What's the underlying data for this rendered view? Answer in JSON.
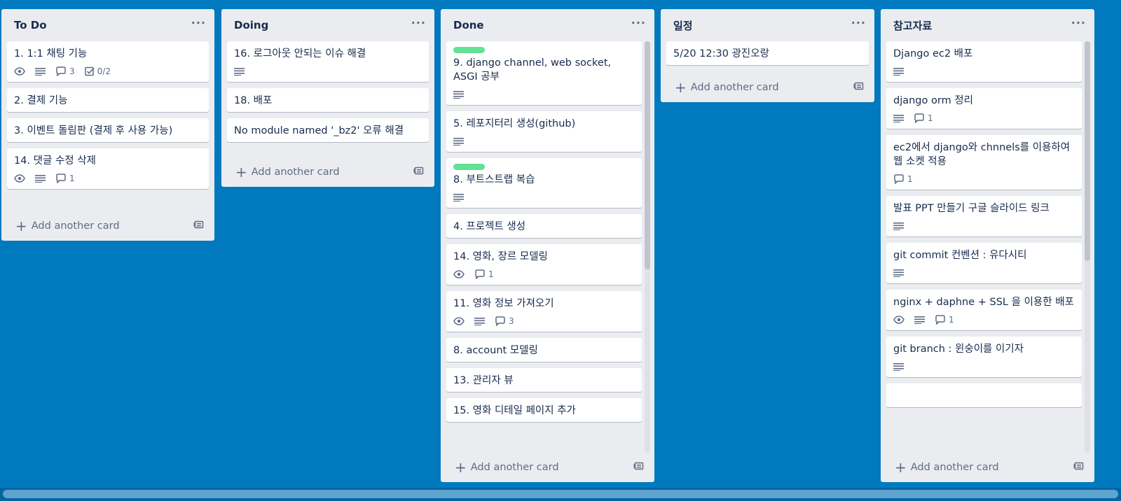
{
  "board": {
    "lists": [
      {
        "title": "To Do",
        "menu": "···",
        "add_card": "Add another card",
        "cards": [
          {
            "title": "1. 1:1 채팅 기능",
            "watch": true,
            "description": true,
            "comments": "3",
            "checklist": "0/2"
          },
          {
            "title": "2. 결제 기능"
          },
          {
            "title": "3. 이벤트 돌림판 (결제 후 사용 가능)"
          },
          {
            "title": "14. 댓글 수정 삭제",
            "watch": true,
            "description": true,
            "comments": "1"
          }
        ]
      },
      {
        "title": "Doing",
        "menu": "···",
        "add_card": "Add another card",
        "cards": [
          {
            "title": "16. 로그아웃 안되는 이슈 해결",
            "description": true
          },
          {
            "title": "18. 배포"
          },
          {
            "title": "No module named '_bz2' 오류 해결"
          }
        ]
      },
      {
        "title": "Done",
        "menu": "···",
        "add_card": "Add another card",
        "cards": [
          {
            "title": "9. django channel, web socket, ASGI 공부",
            "label_color": "#61e294",
            "description": true
          },
          {
            "title": "5. 레포지터리 생성(github)",
            "description": true
          },
          {
            "title": "8. 부트스트랩 복습",
            "label_color": "#61e294",
            "description": true
          },
          {
            "title": "4. 프로젝트 생성"
          },
          {
            "title": "14. 영화, 장르 모델링",
            "watch": true,
            "comments": "1"
          },
          {
            "title": "11. 영화 정보 가져오기",
            "watch": true,
            "description": true,
            "comments": "3"
          },
          {
            "title": "8. account 모델링"
          },
          {
            "title": "13. 관리자 뷰"
          },
          {
            "title": "15. 영화 디테일 페이지 추가"
          }
        ]
      },
      {
        "title": "일정",
        "menu": "···",
        "add_card": "Add another card",
        "cards": [
          {
            "title": "5/20 12:30 광진오랑"
          }
        ]
      },
      {
        "title": "참고자료",
        "menu": "···",
        "add_card": "Add another card",
        "cards": [
          {
            "title": "Django ec2 배포",
            "description": true
          },
          {
            "title": "django orm 정리",
            "description": true,
            "comments": "1"
          },
          {
            "title": "ec2에서 django와 chnnels를 이용하여 웹 소켓 적용",
            "comments": "1"
          },
          {
            "title": "발표 PPT 만들기 구글 슬라이드 링크",
            "description": true
          },
          {
            "title": "git commit 컨벤션 : 유다시티",
            "description": true
          },
          {
            "title": "nginx + daphne + SSL 을 이용한 배포",
            "watch": true,
            "description": true,
            "comments": "1"
          },
          {
            "title": "git branch : 윈숭이를 이기자",
            "description": true
          },
          {
            "title": ""
          }
        ]
      }
    ]
  }
}
